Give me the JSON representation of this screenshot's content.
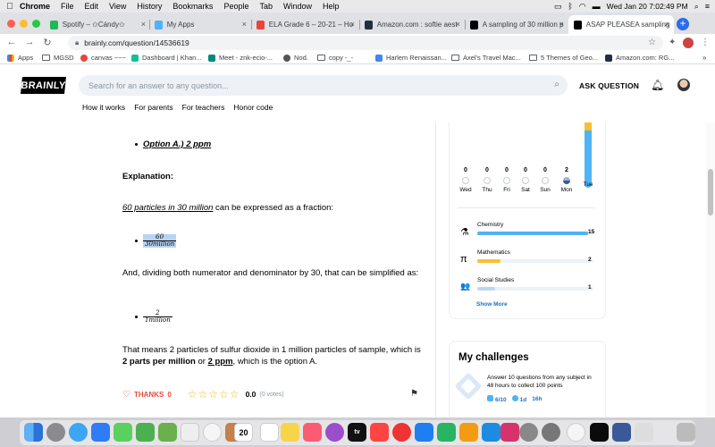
{
  "menubar": {
    "app_name": "Chrome",
    "items": [
      "File",
      "Edit",
      "View",
      "History",
      "Bookmarks",
      "People",
      "Tab",
      "Window",
      "Help"
    ],
    "clock": "Wed Jan 20  7:02:49 PM"
  },
  "tabs": [
    {
      "title": "Spotify – ✩Cándy✩",
      "favicon_color": "#1db954",
      "active": false
    },
    {
      "title": "My Apps",
      "favicon_color": "#4fb3f6",
      "active": false
    },
    {
      "title": "ELA Grade 6 – 20-21 – Ho",
      "favicon_color": "#e8453c",
      "active": false
    },
    {
      "title": "Amazon.com : softie aest",
      "favicon_color": "#232f3e",
      "active": false
    },
    {
      "title": "A sampling of 30 million p",
      "favicon_color": "#000000",
      "active": false
    },
    {
      "title": "ASAP PLEASEA sampling",
      "favicon_color": "#000000",
      "active": true
    }
  ],
  "toolbar": {
    "url": "brainly.com/question/14536619"
  },
  "bookmarks": [
    {
      "label": "Apps",
      "type": "grid"
    },
    {
      "label": "MGSD",
      "type": "folder"
    },
    {
      "label": "canvas ~~~",
      "type": "icon",
      "color": "#e8453c"
    },
    {
      "label": "Dashboard | Khan...",
      "type": "icon",
      "color": "#14bf96"
    },
    {
      "label": "Meet - znk-ecio-...",
      "type": "icon",
      "color": "#00897b"
    },
    {
      "label": "Nod.",
      "type": "icon",
      "color": "#555555"
    },
    {
      "label": "copy -_-",
      "type": "folder"
    },
    {
      "label": "Harlem Renaissan...",
      "type": "icon",
      "color": "#4285f4"
    },
    {
      "label": "Axel's Travel Mac...",
      "type": "folder"
    },
    {
      "label": "5 Themes of Geo...",
      "type": "folder"
    },
    {
      "label": "Amazon.com: RG...",
      "type": "icon",
      "color": "#232f3e"
    }
  ],
  "header": {
    "logo": "BRAINLY",
    "search_placeholder": "Search for an answer to any question...",
    "ask_label": "ASK QUESTION",
    "nav": [
      "How it works",
      "For parents",
      "For teachers",
      "Honor code"
    ]
  },
  "answer": {
    "option_line": "Option A.) 2 ppm",
    "explanation_heading": "Explanation:",
    "p1_underlined": "60 particles in 30 million",
    "p1_rest": " can be expressed as a fraction:",
    "frac1_num": "60",
    "frac1_den": "30million",
    "p2": "And, dividing both numerator and denominator by 30, that can be simplified as:",
    "frac2_num": "2",
    "frac2_den": "1million",
    "p3_start": "That means 2 particles of sulfur dioxide in 1 million particles of sample, which is ",
    "p3_bold": "2 parts per million",
    "p3_mid": " or ",
    "p3_bold_u": " 2 ppm",
    "p3_end": ", which is the option A."
  },
  "actions": {
    "thanks_label": "THANKS",
    "thanks_count": "0",
    "rating": "0.0",
    "votes": "(0 votes)",
    "stars_filled": 0
  },
  "weekly": {
    "days": [
      {
        "count": "0",
        "label": "Wed"
      },
      {
        "count": "0",
        "label": "Thu"
      },
      {
        "count": "0",
        "label": "Fri"
      },
      {
        "count": "0",
        "label": "Sat"
      },
      {
        "count": "0",
        "label": "Sun"
      },
      {
        "count": "2",
        "label": "Mon"
      },
      {
        "count": "",
        "label": "Tue"
      }
    ]
  },
  "subjects": [
    {
      "name": "Chemistry",
      "count": "15",
      "icon": "flask-icon",
      "glyph": "⚗",
      "fill_fraction": 0.95,
      "color": "#4fb3f6"
    },
    {
      "name": "Mathematics",
      "count": "2",
      "icon": "pi-icon",
      "glyph": "π",
      "fill_fraction": 0.2,
      "color": "#fbbe2e"
    },
    {
      "name": "Social Studies",
      "count": "1",
      "icon": "people-icon",
      "glyph": "👥",
      "fill_fraction": 0.15,
      "color": "#bdd5f5"
    }
  ],
  "show_more": "Show More",
  "challenges": {
    "title": "My challenges",
    "text": "Answer 10 questions from any subject in 48 hours to collect 100 points",
    "progress": "6/10",
    "time1": "1d",
    "time2": "16h"
  }
}
